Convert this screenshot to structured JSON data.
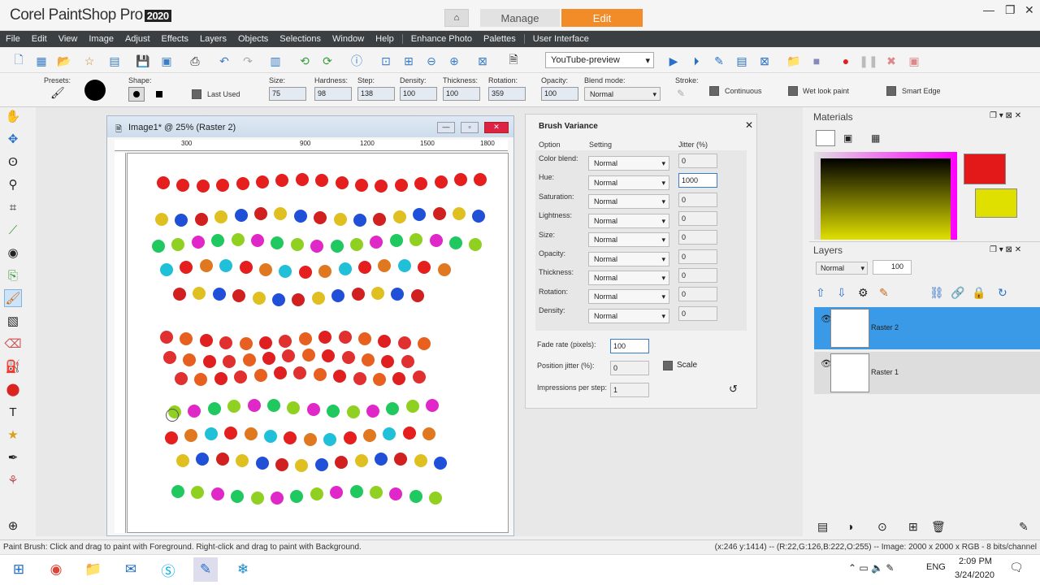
{
  "app": {
    "logo": "Corel PaintShop Pro",
    "year": "2020",
    "home_icon": "home-icon"
  },
  "tabs": {
    "manage": "Manage",
    "edit": "Edit"
  },
  "menu": [
    "File",
    "Edit",
    "View",
    "Image",
    "Adjust",
    "Effects",
    "Layers",
    "Objects",
    "Selections",
    "Window",
    "Help",
    "Enhance Photo",
    "Palettes",
    "User Interface"
  ],
  "toolbar": {
    "preset_dropdown": "YouTube-preview"
  },
  "options": {
    "presets_label": "Presets:",
    "shape_label": "Shape:",
    "last_used": "Last Used",
    "size_label": "Size:",
    "size": "75",
    "hardness_label": "Hardness:",
    "hardness": "98",
    "step_label": "Step:",
    "step": "138",
    "density_label": "Density:",
    "density": "100",
    "thickness_label": "Thickness:",
    "thickness": "100",
    "rotation_label": "Rotation:",
    "rotation": "359",
    "opacity_label": "Opacity:",
    "opacity": "100",
    "blend_label": "Blend mode:",
    "blend": "Normal",
    "stroke_label": "Stroke:",
    "continuous": "Continuous",
    "wet_look": "Wet look paint",
    "smart_edge": "Smart Edge"
  },
  "image_window": {
    "title": "Image1* @  25% (Raster 2)"
  },
  "brush_variance": {
    "title": "Brush Variance",
    "col_option": "Option",
    "col_setting": "Setting",
    "col_jitter": "Jitter (%)",
    "rows": [
      {
        "label": "Color blend:",
        "setting": "Normal",
        "jitter": "0"
      },
      {
        "label": "Hue:",
        "setting": "Normal",
        "jitter": "1000"
      },
      {
        "label": "Saturation:",
        "setting": "Normal",
        "jitter": "0"
      },
      {
        "label": "Lightness:",
        "setting": "Normal",
        "jitter": "0"
      },
      {
        "label": "Size:",
        "setting": "Normal",
        "jitter": "0"
      },
      {
        "label": "Opacity:",
        "setting": "Normal",
        "jitter": "0"
      },
      {
        "label": "Thickness:",
        "setting": "Normal",
        "jitter": "0"
      },
      {
        "label": "Rotation:",
        "setting": "Normal",
        "jitter": "0"
      },
      {
        "label": "Density:",
        "setting": "Normal",
        "jitter": "0"
      }
    ],
    "fade_label": "Fade rate (pixels):",
    "fade": "100",
    "posjit_label": "Position jitter (%):",
    "posjit": "0",
    "scale": "Scale",
    "imp_label": "Impressions per step:",
    "imp": "1"
  },
  "materials": {
    "title": "Materials",
    "fg_color": "#ffffff",
    "bg_color": "#e31818",
    "swatch2": "#e0e000"
  },
  "layers": {
    "title": "Layers",
    "blend": "Normal",
    "opacity": "100",
    "items": [
      {
        "name": "Raster 2"
      },
      {
        "name": "Raster 1"
      }
    ]
  },
  "status": {
    "left": "Paint Brush: Click and drag to paint with Foreground. Right-click and drag to paint with Background.",
    "right": "(x:246 y:1414) -- (R:22,G:126,B:222,O:255) -- Image:  2000 x 2000 x RGB - 8 bits/channel"
  },
  "taskbar": {
    "time": "2:09 PM",
    "date": "3/24/2020",
    "lang": "ENG"
  },
  "ruler": {
    "top": [
      "300",
      "900",
      "1200",
      "1500",
      "1800"
    ]
  }
}
